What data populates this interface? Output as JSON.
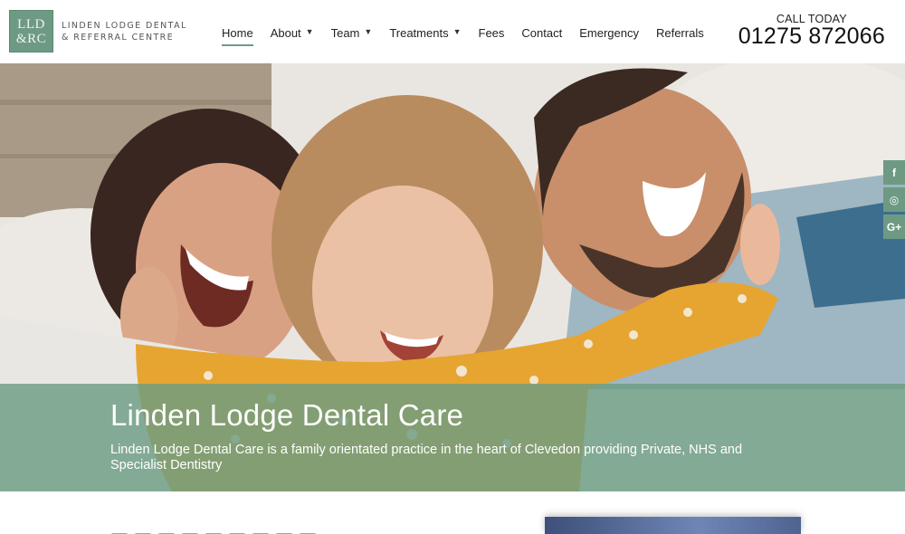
{
  "logo": {
    "monogram_line1": "LLD",
    "monogram_line2": "&RC",
    "name_line1": "LINDEN LODGE DENTAL",
    "name_line2": "& REFERRAL CENTRE"
  },
  "nav": {
    "items": [
      {
        "label": "Home",
        "active": true,
        "has_dropdown": false
      },
      {
        "label": "About",
        "active": false,
        "has_dropdown": true
      },
      {
        "label": "Team",
        "active": false,
        "has_dropdown": true
      },
      {
        "label": "Treatments",
        "active": false,
        "has_dropdown": true
      },
      {
        "label": "Fees",
        "active": false,
        "has_dropdown": false
      },
      {
        "label": "Contact",
        "active": false,
        "has_dropdown": false
      },
      {
        "label": "Emergency",
        "active": false,
        "has_dropdown": false
      },
      {
        "label": "Referrals",
        "active": false,
        "has_dropdown": false
      }
    ]
  },
  "call": {
    "label": "CALL TODAY",
    "number": "01275 872066"
  },
  "social": [
    {
      "icon": "facebook-icon",
      "glyph": "f"
    },
    {
      "icon": "instagram-icon",
      "glyph": "◎"
    },
    {
      "icon": "google-plus-icon",
      "glyph": "G+"
    }
  ],
  "hero": {
    "title": "Linden Lodge Dental Care",
    "text": "Linden Lodge Dental Care is a family orientated practice in the heart of Clevedon providing Private, NHS and Specialist Dentistry"
  },
  "colors": {
    "brand": "#6e9a84",
    "banner": "#6c9c82"
  }
}
